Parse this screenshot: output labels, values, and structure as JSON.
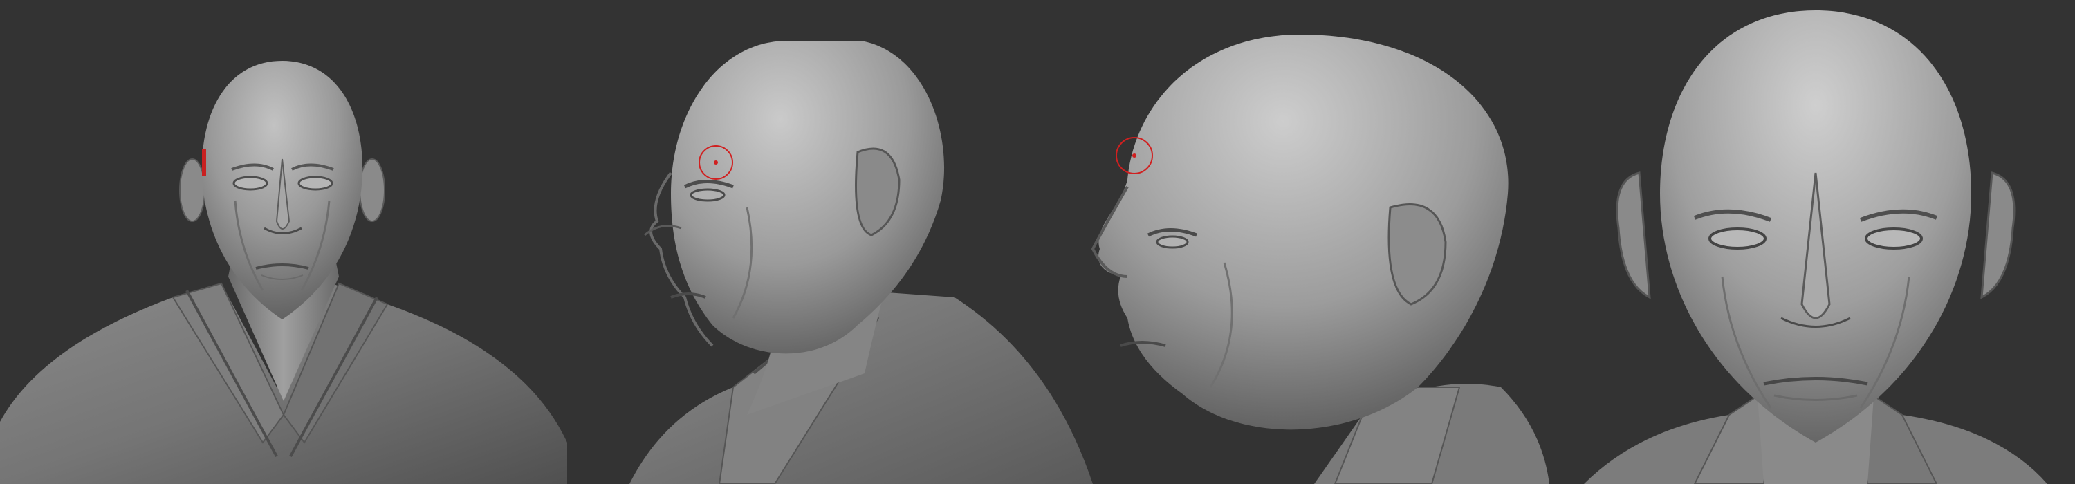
{
  "scene": {
    "background_color": "#333333",
    "clay_color": "#8e8e8e",
    "highlight_color": "#c4c4c4",
    "shadow_color": "#3c3c3c",
    "brush_cursor_color": "#d02020"
  },
  "views": [
    {
      "id": "front-bust",
      "icon": "sculpt-front-bust"
    },
    {
      "id": "three-quarter-left",
      "icon": "sculpt-three-quarter",
      "brush_cursor": true
    },
    {
      "id": "profile-left",
      "icon": "sculpt-profile",
      "brush_cursor": true
    },
    {
      "id": "front-closeup",
      "icon": "sculpt-front-closeup"
    }
  ]
}
